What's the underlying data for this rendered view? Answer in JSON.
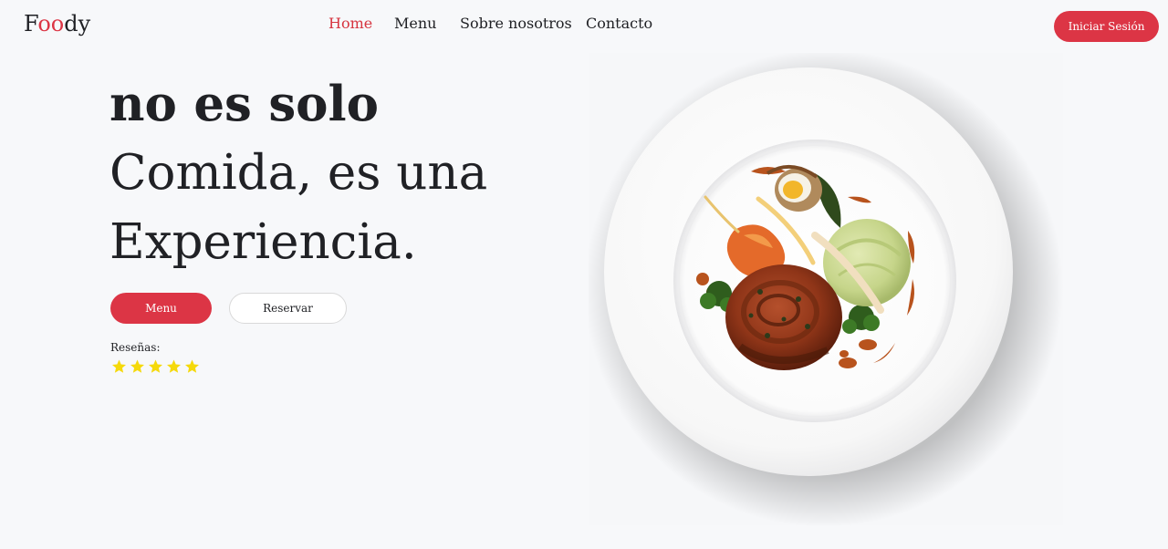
{
  "header": {
    "logo_prefix": "F",
    "logo_accent": "oo",
    "logo_suffix": "dy",
    "nav": [
      {
        "label": "Home",
        "active": true
      },
      {
        "label": "Menu",
        "active": false
      },
      {
        "label": "Sobre nosotros",
        "active": false
      },
      {
        "label": "Contacto",
        "active": false
      }
    ],
    "login_label": "Iniciar Sesión"
  },
  "hero": {
    "title_lines": [
      "no es solo",
      "Comida, es una",
      "Experiencia."
    ],
    "menu_button": "Menu",
    "reserve_button": "Reservar",
    "reviews_label": "Reseñas:",
    "rating": 5,
    "rating_max": 5
  },
  "image": {
    "icon": "plated-dish-image"
  },
  "colors": {
    "accent": "#dc3545",
    "text": "#1f2024",
    "background": "#f7f8fa",
    "star": "#f5d90a"
  }
}
